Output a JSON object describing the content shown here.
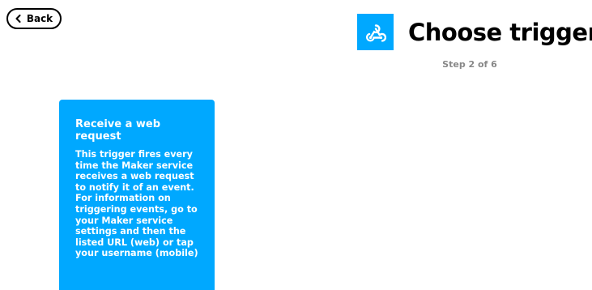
{
  "nav": {
    "back_label": "Back"
  },
  "header": {
    "title": "Choose trigger",
    "service_icon": "webhook-icon",
    "step": "Step 2 of 6"
  },
  "triggers": [
    {
      "title": "Receive a web request",
      "description": "This trigger fires every time the Maker service receives a web request to notify it of an event. For information on triggering events, go to your Maker service settings and then the listed URL (web) or tap your username (mobile)"
    }
  ],
  "colors": {
    "accent": "#00a8ff",
    "text": "#000000",
    "muted": "#888888"
  }
}
